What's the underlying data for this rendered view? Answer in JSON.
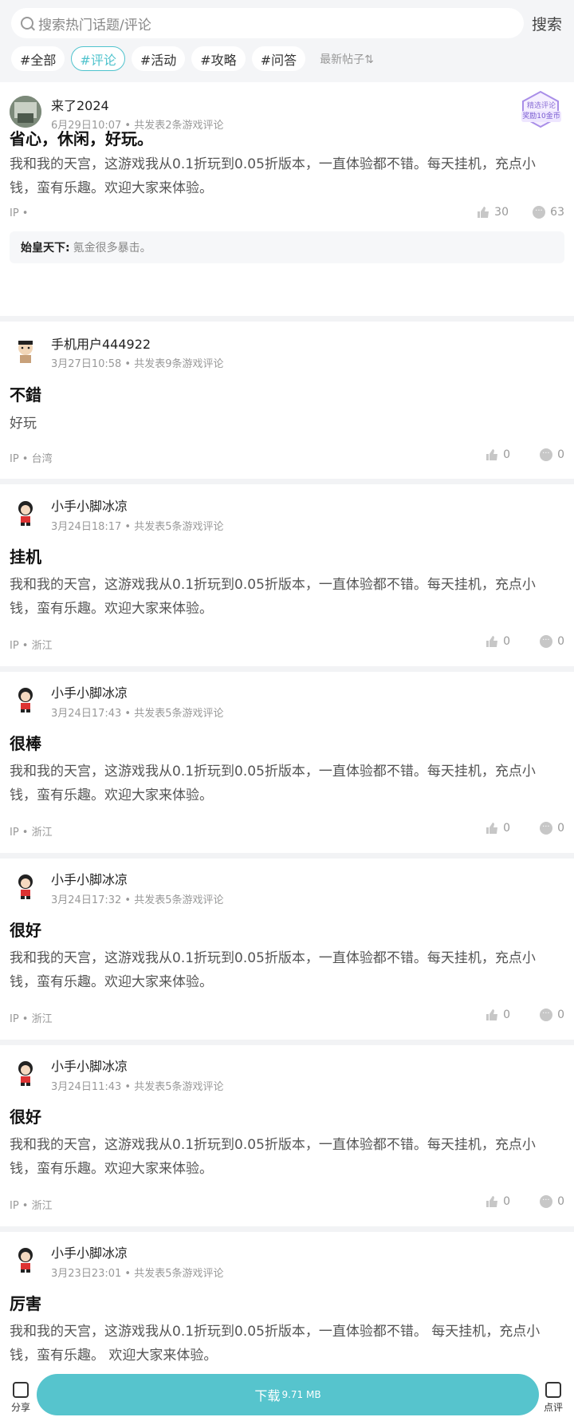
{
  "search": {
    "placeholder": "搜索热门话题/评论",
    "button": "搜索"
  },
  "tabs": [
    "#全部",
    "#评论",
    "#活动",
    "#攻略",
    "#问答"
  ],
  "active_tab": 1,
  "sort_label": "最新帖子⇅",
  "badge": {
    "top": "精选评论",
    "bottom": "奖励10金币"
  },
  "posts": [
    {
      "author": "来了2024",
      "meta": "6月29日10:07 • 共发表2条游戏评论",
      "title": "省心，休闲，好玩。",
      "body": "我和我的天宫，这游戏我从0.1折玩到0.05折版本，一直体验都不错。每天挂机，充点小钱，蛮有乐趣。欢迎大家来体验。",
      "ip": "IP •",
      "likes": "30",
      "comments": "63",
      "reply": {
        "name": "始皇天下:",
        "text": "氪金很多暴击。"
      }
    },
    {
      "author": "手机用户444922",
      "meta": "3月27日10:58 • 共发表9条游戏评论",
      "title": "不錯",
      "body": "好玩",
      "ip": "IP • 台湾",
      "likes": "0",
      "comments": "0"
    },
    {
      "author": "小手小脚冰凉",
      "meta": "3月24日18:17 • 共发表5条游戏评论",
      "title": "挂机",
      "body": "我和我的天宫，这游戏我从0.1折玩到0.05折版本，一直体验都不错。每天挂机，充点小钱，蛮有乐趣。欢迎大家来体验。",
      "ip": "IP • 浙江",
      "likes": "0",
      "comments": "0"
    },
    {
      "author": "小手小脚冰凉",
      "meta": "3月24日17:43 • 共发表5条游戏评论",
      "title": "很棒",
      "body": "我和我的天宫，这游戏我从0.1折玩到0.05折版本，一直体验都不错。每天挂机，充点小钱，蛮有乐趣。欢迎大家来体验。",
      "ip": "IP • 浙江",
      "likes": "0",
      "comments": "0"
    },
    {
      "author": "小手小脚冰凉",
      "meta": "3月24日17:32 • 共发表5条游戏评论",
      "title": "很好",
      "body": "我和我的天宫，这游戏我从0.1折玩到0.05折版本，一直体验都不错。每天挂机，充点小钱，蛮有乐趣。欢迎大家来体验。",
      "ip": "IP • 浙江",
      "likes": "0",
      "comments": "0"
    },
    {
      "author": "小手小脚冰凉",
      "meta": "3月24日11:43 • 共发表5条游戏评论",
      "title": "很好",
      "body": "我和我的天宫，这游戏我从0.1折玩到0.05折版本，一直体验都不错。每天挂机，充点小钱，蛮有乐趣。欢迎大家来体验。",
      "ip": "IP • 浙江",
      "likes": "0",
      "comments": "0"
    },
    {
      "author": "小手小脚冰凉",
      "meta": "3月23日23:01 • 共发表5条游戏评论",
      "title": "厉害",
      "body": "我和我的天宫，这游戏我从0.1折玩到0.05折版本，一直体验都不错。 每天挂机，充点小钱，蛮有乐趣。 欢迎大家来体验。"
    }
  ],
  "bottom": {
    "share": "分享",
    "download": "下载",
    "download_size": "9.71 MB",
    "review": "点评"
  },
  "colors": {
    "accent": "#56c4cd",
    "badge": "#8b6fd6"
  }
}
